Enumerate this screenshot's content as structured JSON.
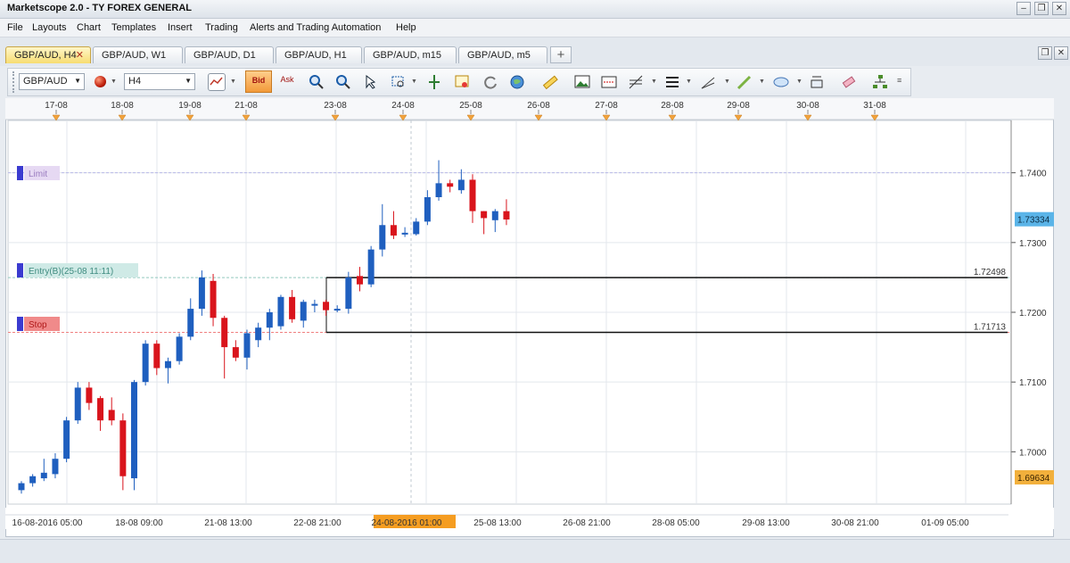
{
  "window": {
    "title": "Marketscope 2.0 - TY FOREX GENERAL",
    "controls": [
      "minimize",
      "restore",
      "close"
    ]
  },
  "menu": [
    "File",
    "Layouts",
    "Chart",
    "Templates",
    "Insert",
    "Trading",
    "Alerts and Trading Automation",
    "Help"
  ],
  "tabs": [
    {
      "label": "GBP/AUD, H4",
      "active": true
    },
    {
      "label": "GBP/AUD, W1"
    },
    {
      "label": "GBP/AUD, D1"
    },
    {
      "label": "GBP/AUD, H1"
    },
    {
      "label": "GBP/AUD, m15"
    },
    {
      "label": "GBP/AUD, m5"
    }
  ],
  "add_tab_label": "+",
  "toolbar": {
    "symbol": "GBP/AUD",
    "timeframe": "H4",
    "bid_label": "Bid",
    "ask_label": "Ask",
    "icons": [
      "chart-type-icon",
      "bid-icon",
      "ask-icon",
      "zoom-in-icon",
      "zoom-out-icon",
      "cursor-icon",
      "zoom-rect-icon",
      "fit-icon",
      "marker-icon",
      "refresh-icon",
      "globe-icon",
      "ruler-icon",
      "image-icon",
      "screenshot-icon",
      "fibonacci-icon",
      "lines-icon",
      "trendline-icon",
      "pen-icon",
      "ellipse-icon",
      "text-icon",
      "eraser-icon",
      "hierarchy-icon"
    ]
  },
  "chart": {
    "top_dates": [
      "17-08",
      "18-08",
      "19-08",
      "21-08",
      "23-08",
      "24-08",
      "25-08",
      "26-08",
      "27-08",
      "28-08",
      "29-08",
      "30-08",
      "31-08"
    ],
    "bottom_dates": [
      "16-08-2016 05:00",
      "18-08 09:00",
      "21-08 13:00",
      "22-08 21:00",
      "24-08-2016 01:00",
      "25-08 13:00",
      "26-08 21:00",
      "28-08 05:00",
      "29-08 13:00",
      "30-08 21:00",
      "01-09 05:00"
    ],
    "highlight_date": "24-08-2016 01:00",
    "price_ticks": [
      "1.7400",
      "1.7300",
      "1.7200",
      "1.7100",
      "1.7000"
    ],
    "current_price": "1.73334",
    "low_price_tag": "1.69634",
    "order_labels": {
      "limit": "Limit",
      "entry": "Entry(B)(25-08 11:11)",
      "stop": "Stop"
    },
    "levels": {
      "entry_level": "1.72498",
      "stop_level": "1.71713"
    },
    "colors": {
      "up": "#1f5fbf",
      "down": "#d9141c",
      "current_tag": "#5ab4e8",
      "low_tag": "#f2b03c",
      "highlight": "#f59d21"
    }
  },
  "chart_data": {
    "type": "candlestick",
    "symbol": "GBP/AUD",
    "timeframe": "H4",
    "ylim": [
      1.6925,
      1.7475
    ],
    "candles": [
      {
        "o": 1.6945,
        "h": 1.6958,
        "l": 1.694,
        "c": 1.6955
      },
      {
        "o": 1.6955,
        "h": 1.6968,
        "l": 1.695,
        "c": 1.6965
      },
      {
        "o": 1.6962,
        "h": 1.699,
        "l": 1.6958,
        "c": 1.697
      },
      {
        "o": 1.6968,
        "h": 1.6998,
        "l": 1.6962,
        "c": 1.699
      },
      {
        "o": 1.699,
        "h": 1.705,
        "l": 1.6985,
        "c": 1.7045
      },
      {
        "o": 1.7045,
        "h": 1.71,
        "l": 1.704,
        "c": 1.7092
      },
      {
        "o": 1.7092,
        "h": 1.71,
        "l": 1.706,
        "c": 1.707
      },
      {
        "o": 1.7077,
        "h": 1.708,
        "l": 1.703,
        "c": 1.7045
      },
      {
        "o": 1.706,
        "h": 1.7078,
        "l": 1.7038,
        "c": 1.7045
      },
      {
        "o": 1.7045,
        "h": 1.7055,
        "l": 1.6945,
        "c": 1.6965
      },
      {
        "o": 1.6962,
        "h": 1.7103,
        "l": 1.6945,
        "c": 1.71
      },
      {
        "o": 1.71,
        "h": 1.716,
        "l": 1.7095,
        "c": 1.7155
      },
      {
        "o": 1.7155,
        "h": 1.716,
        "l": 1.711,
        "c": 1.712
      },
      {
        "o": 1.712,
        "h": 1.7135,
        "l": 1.7098,
        "c": 1.713
      },
      {
        "o": 1.713,
        "h": 1.717,
        "l": 1.7125,
        "c": 1.7165
      },
      {
        "o": 1.7165,
        "h": 1.722,
        "l": 1.716,
        "c": 1.7205
      },
      {
        "o": 1.7205,
        "h": 1.726,
        "l": 1.7195,
        "c": 1.725
      },
      {
        "o": 1.7245,
        "h": 1.7255,
        "l": 1.718,
        "c": 1.7192
      },
      {
        "o": 1.7192,
        "h": 1.7195,
        "l": 1.7105,
        "c": 1.715
      },
      {
        "o": 1.715,
        "h": 1.716,
        "l": 1.713,
        "c": 1.7135
      },
      {
        "o": 1.7135,
        "h": 1.7175,
        "l": 1.7118,
        "c": 1.717
      },
      {
        "o": 1.716,
        "h": 1.7185,
        "l": 1.715,
        "c": 1.7178
      },
      {
        "o": 1.7178,
        "h": 1.7205,
        "l": 1.716,
        "c": 1.72
      },
      {
        "o": 1.718,
        "h": 1.7225,
        "l": 1.7175,
        "c": 1.7222
      },
      {
        "o": 1.7222,
        "h": 1.7232,
        "l": 1.7185,
        "c": 1.719
      },
      {
        "o": 1.7188,
        "h": 1.7218,
        "l": 1.7178,
        "c": 1.7215
      },
      {
        "o": 1.721,
        "h": 1.7218,
        "l": 1.72,
        "c": 1.7212
      },
      {
        "o": 1.7215,
        "h": 1.7218,
        "l": 1.7195,
        "c": 1.7203
      },
      {
        "o": 1.7203,
        "h": 1.721,
        "l": 1.72,
        "c": 1.7205
      },
      {
        "o": 1.7205,
        "h": 1.7258,
        "l": 1.7198,
        "c": 1.725
      },
      {
        "o": 1.7252,
        "h": 1.7265,
        "l": 1.723,
        "c": 1.724
      },
      {
        "o": 1.724,
        "h": 1.7295,
        "l": 1.7236,
        "c": 1.729
      },
      {
        "o": 1.729,
        "h": 1.7355,
        "l": 1.728,
        "c": 1.7325
      },
      {
        "o": 1.7325,
        "h": 1.7345,
        "l": 1.7305,
        "c": 1.731
      },
      {
        "o": 1.7312,
        "h": 1.7322,
        "l": 1.7308,
        "c": 1.7314
      },
      {
        "o": 1.7312,
        "h": 1.7335,
        "l": 1.731,
        "c": 1.733
      },
      {
        "o": 1.733,
        "h": 1.7375,
        "l": 1.7325,
        "c": 1.7365
      },
      {
        "o": 1.7365,
        "h": 1.7418,
        "l": 1.736,
        "c": 1.7385
      },
      {
        "o": 1.7385,
        "h": 1.739,
        "l": 1.7372,
        "c": 1.738
      },
      {
        "o": 1.7375,
        "h": 1.7405,
        "l": 1.737,
        "c": 1.739
      },
      {
        "o": 1.739,
        "h": 1.7398,
        "l": 1.7328,
        "c": 1.7345
      },
      {
        "o": 1.7345,
        "h": 1.7345,
        "l": 1.7312,
        "c": 1.7335
      },
      {
        "o": 1.7332,
        "h": 1.7348,
        "l": 1.7315,
        "c": 1.7345
      },
      {
        "o": 1.7345,
        "h": 1.7362,
        "l": 1.7325,
        "c": 1.7333
      }
    ],
    "horizontal_levels": {
      "limit": 1.74,
      "entry": 1.72498,
      "stop": 1.71713
    }
  }
}
